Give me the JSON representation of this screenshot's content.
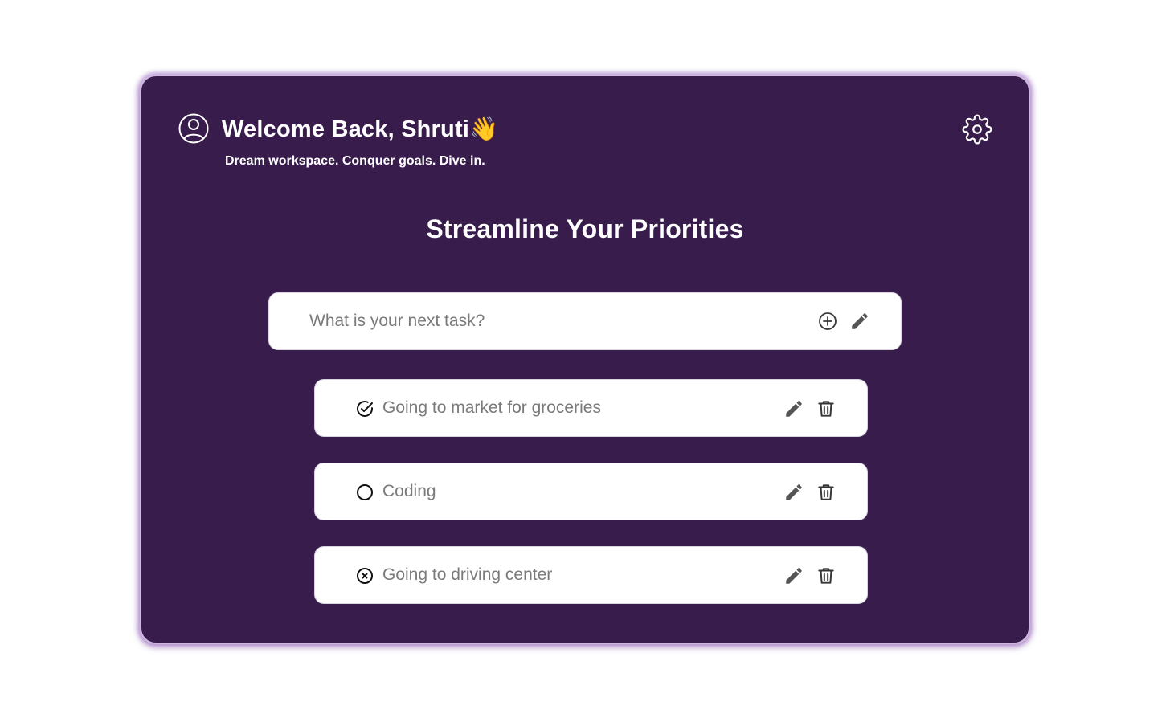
{
  "header": {
    "greeting": "Welcome Back, Shruti👋",
    "subtitle": "Dream workspace. Conquer goals. Dive in.",
    "avatar_icon": "user-circle-icon",
    "settings_icon": "gear-icon"
  },
  "main": {
    "heading": "Streamline Your Priorities"
  },
  "task_input": {
    "placeholder": "What is your next task?",
    "value": "",
    "add_icon": "plus-circle-icon",
    "edit_icon": "pencil-icon"
  },
  "tasks": [
    {
      "label": "Going to market for groceries",
      "status": "completed",
      "status_icon": "check-circle-icon"
    },
    {
      "label": "Coding",
      "status": "pending",
      "status_icon": "circle-icon"
    },
    {
      "label": "Going to driving center",
      "status": "cancelled",
      "status_icon": "x-circle-icon"
    }
  ],
  "colors": {
    "card_background": "#381c4c",
    "card_border": "#cfb8e0",
    "text_light": "#ffffff",
    "task_text": "#7a7a7a"
  }
}
